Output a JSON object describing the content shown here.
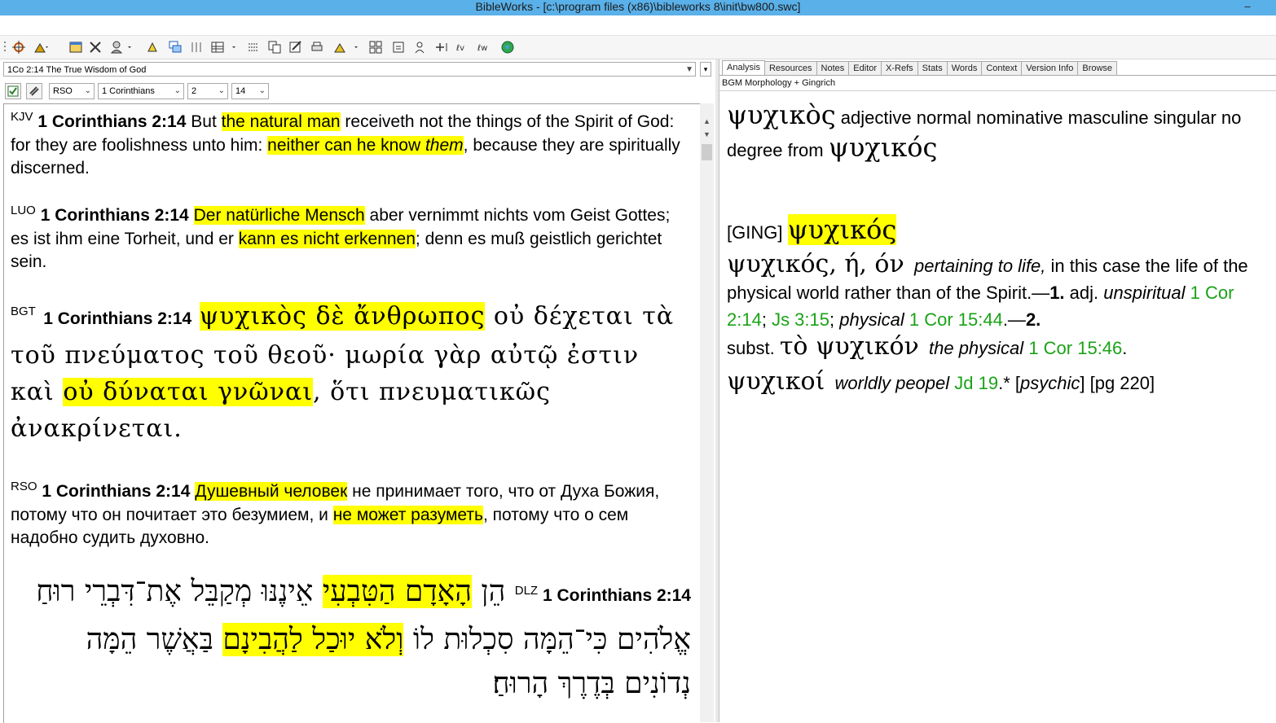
{
  "window": {
    "title": "BibleWorks - [c:\\program files (x86)\\bibleworks 8\\init\\bw800.swc]",
    "minimize": "–"
  },
  "left": {
    "reference_combo": "1Co 2:14 The True Wisdom of God",
    "version_select": "RSO",
    "book_select": "1 Corinthians",
    "chapter_select": "2",
    "verse_select": "14",
    "verses": [
      {
        "version": "KJV",
        "ref": "1 Corinthians 2:14"
      },
      {
        "version": "LUO",
        "ref": "1 Corinthians 2:14"
      },
      {
        "version": "BGT",
        "ref": "1 Corinthians 2:14"
      },
      {
        "version": "RSO",
        "ref": "1 Corinthians 2:14"
      },
      {
        "version": "DLZ",
        "ref": "1 Corinthians 2:14"
      }
    ],
    "kjv": {
      "t1": "But ",
      "h1": "the natural man",
      "t2": " receiveth not the things of the Spirit of God: for they are foolishness unto him: ",
      "h2a": "neither can he know ",
      "h2b": "them",
      "t3": ", because they are spiritually discerned."
    },
    "luo": {
      "h1": "Der natürliche Mensch",
      "t1": " aber vernimmt nichts vom Geist Gottes; es ist ihm eine Torheit, und er ",
      "h2": "kann es nicht erkennen",
      "t2": "; denn es muß geistlich gerichtet sein."
    },
    "bgt": {
      "h1": "ψυχικὸς δὲ ἄνθρωπος",
      "t1": " οὐ δέχεται τὰ τοῦ πνεύματος τοῦ θεοῦ· μωρία γὰρ αὐτῷ ἐστιν καὶ ",
      "h2": "οὐ δύναται γνῶναι",
      "t2": ", ὅτι πνευματικῶς ἀνακρίνεται."
    },
    "rso": {
      "h1": "Душевный человек",
      "t1": " не принимает того, что от Духа Божия, потому что он почитает это безумием, и ",
      "h2": "не может разуметь",
      "t2": ", потому что о сем надобно судить духовно."
    },
    "dlz": {
      "t0": "הֵן ",
      "h1": "הָאָדָם הַטִּבְעִי",
      "t1": " אֵינֶנּוּ מְקַבֵּל אֶת־דִּבְרֵי רוּחַ אֱלֹהִים כִּי־הֵמָּה סִכְלוּת לוֹ ",
      "h2": "וְלֹא יוּכַל לַהֲבִינָם",
      "t2": " בַּאֲשֶׁר הֵמָּה נְדוֹנִים בְּדֶרֶךְ הָרוּחַ׃"
    }
  },
  "right": {
    "tabs": [
      "Analysis",
      "Resources",
      "Notes",
      "Editor",
      "X-Refs",
      "Stats",
      "Words",
      "Context",
      "Version Info",
      "Browse"
    ],
    "active_tab": "Analysis",
    "subheader": "BGM Morphology + Gingrich",
    "morph": {
      "word": "ψυχικὸς",
      "desc": "adjective normal nominative masculine singular no degree from",
      "lemma": "ψυχικός"
    },
    "ging": {
      "label": "[GING]",
      "headword": "ψυχικός",
      "forms": "ψυχικός, ή, όν",
      "def1": "pertaining to life,",
      "def2": " in this case the life of the physical world rather than of the Spirit.—",
      "n1": "1.",
      "adj": " adj. ",
      "unspiritual": "unspiritual",
      "ref1": "1 Cor 2:14",
      "sep1": "; ",
      "ref2": "Js 3:15",
      "sep2": "; ",
      "physical": "physical",
      "ref3": "1 Cor 15:44",
      "dash2": ".—",
      "n2": "2.",
      "subst": "subst. ",
      "to_psychikon": "τὸ ψυχικόν",
      "the_physical": "the physical",
      "ref4": "1 Cor 15:46",
      "dot": ".",
      "psychikoi": "ψυχικοί",
      "worldly": "worldly peopel",
      "ref5": "Jd 19",
      "tail1": ".* [",
      "psychic": "psychic",
      "tail2": "] [pg 220]"
    }
  },
  "colors": {
    "highlight": "#ffff00",
    "titlebar": "#5ab0e8",
    "link_green": "#1aa317"
  }
}
